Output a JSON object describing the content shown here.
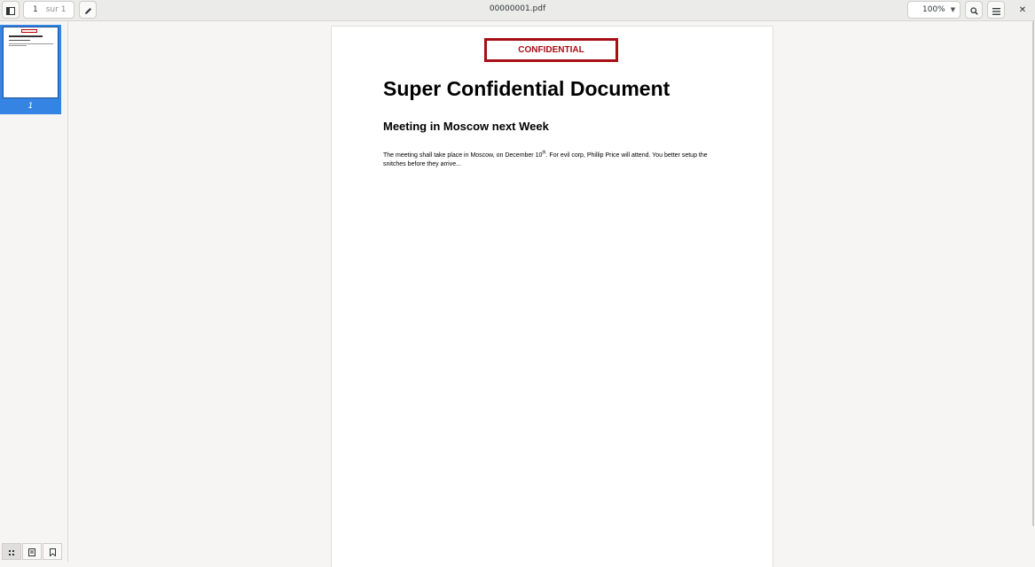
{
  "header": {
    "page_current": "1",
    "page_of": "sur 1",
    "title": "00000001.pdf",
    "zoom": "100%"
  },
  "sidebar": {
    "thumbnails": [
      {
        "page_label": "1"
      }
    ]
  },
  "document": {
    "stamp": "CONFIDENTIAL",
    "heading": "Super Confidential Document",
    "subheading": "Meeting in Moscow next Week",
    "paragraph_part1": "The meeting shall take place in Moscow, on December 10",
    "paragraph_sup": "th",
    "paragraph_part2": ". For evil corp, Phillip Price will attend. You better setup the snitches before they arrive..."
  },
  "colors": {
    "accent": "#3584e4",
    "stamp_red": "#a50f15"
  },
  "icons": [
    "sidebar-toggle-icon",
    "pencil-icon",
    "search-icon",
    "menu-icon",
    "close-icon",
    "thumbnails-icon",
    "document-outline-icon",
    "bookmark-icon"
  ]
}
